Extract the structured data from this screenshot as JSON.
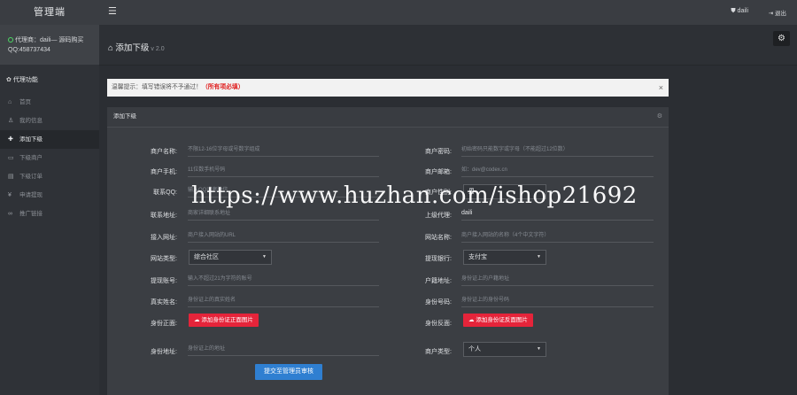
{
  "sidebar": {
    "brand": "管理端",
    "agent_line1": "代理商：daili— 源码购买",
    "agent_line2": "QQ:458737434",
    "section_title": "代理功能",
    "items": [
      {
        "label": "首页",
        "icon": "home-icon",
        "glyph": "⌂"
      },
      {
        "label": "我的信息",
        "icon": "user-icon",
        "glyph": "♙"
      },
      {
        "label": "添加下级",
        "icon": "add-user-icon",
        "glyph": "✚"
      },
      {
        "label": "下级商户",
        "icon": "monitor-icon",
        "glyph": "▭"
      },
      {
        "label": "下级订单",
        "icon": "document-icon",
        "glyph": "▤"
      },
      {
        "label": "申请提现",
        "icon": "yen-icon",
        "glyph": "¥"
      },
      {
        "label": "推广链接",
        "icon": "link-icon",
        "glyph": "∞"
      }
    ]
  },
  "topbar": {
    "user": "daili",
    "logout": "退出"
  },
  "header": {
    "title": "添加下级",
    "version": "v 2.0"
  },
  "alert": {
    "text": "温馨提示：填写错误将不予通过！",
    "required": "（所有项必填）",
    "close": "×"
  },
  "panel": {
    "title": "添加下级"
  },
  "form": {
    "merchant_name": {
      "label": "商户名称:",
      "placeholder": "不限12-16位字母或号数字组成"
    },
    "merchant_password": {
      "label": "商户密码:",
      "placeholder": "初始密码只能数字或字母（不能超过12位数）"
    },
    "merchant_phone": {
      "label": "商户手机:",
      "placeholder": "11位数手机号码"
    },
    "merchant_email": {
      "label": "商户邮箱:",
      "placeholder": "如：dev@codex.cn"
    },
    "qq": {
      "label": "联系QQ:",
      "placeholder": "输入QQ或者微信"
    },
    "gender": {
      "label": "商户性别:",
      "value": "男"
    },
    "address": {
      "label": "联系地址:",
      "placeholder": "商家详细联系地址"
    },
    "parent_agent": {
      "label": "上级代理:",
      "value": "daili"
    },
    "website_url": {
      "label": "接入网址:",
      "placeholder": "商户接入网站的URL"
    },
    "website_name": {
      "label": "网站名称:",
      "placeholder": "商户接入网站的名称（4个中文字符）"
    },
    "website_type": {
      "label": "网站类型:",
      "value": "综合社区"
    },
    "withdraw_bank": {
      "label": "提现银行:",
      "value": "支付宝"
    },
    "account_no": {
      "label": "提现账号:",
      "placeholder": "输入不超过21为字符的账号"
    },
    "household": {
      "label": "户籍地址:",
      "placeholder": "身份证上的户籍地址"
    },
    "real_name": {
      "label": "真实姓名:",
      "placeholder": "身份证上的真实姓名"
    },
    "id_number": {
      "label": "身份号码:",
      "placeholder": "身份证上的身份号码"
    },
    "id_front": {
      "label": "身份正面:",
      "button": "添加身份证正面图片"
    },
    "id_back": {
      "label": "身份反面:",
      "button": "添加身份证反面图片"
    },
    "id_address": {
      "label": "身份地址:",
      "placeholder": "身份证上的地址"
    },
    "merchant_type": {
      "label": "商户类型:",
      "value": "个人"
    },
    "submit": "提交至管理员审核"
  },
  "watermark": "https://www.huzhan.com/ishop21692"
}
